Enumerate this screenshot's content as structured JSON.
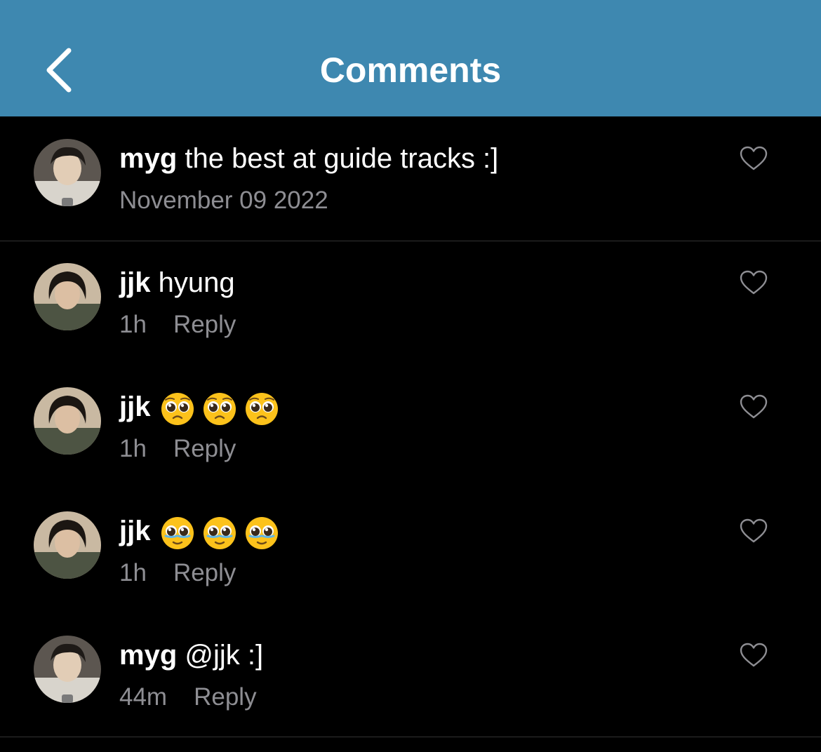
{
  "header": {
    "title": "Comments",
    "back_icon": "chevron-left-icon",
    "background_color": "#3e88b0"
  },
  "caption": {
    "username": "myg",
    "text": " the best at guide tracks :]",
    "date": "November 09 2022",
    "like_icon": "heart-outline-icon"
  },
  "comments": [
    {
      "username": "jjk",
      "text": " hyung",
      "time": "1h",
      "reply_label": "Reply",
      "like_icon": "heart-outline-icon"
    },
    {
      "username": "jjk",
      "emojis": [
        "pleading-face-emoji",
        "pleading-face-emoji",
        "pleading-face-emoji"
      ],
      "time": "1h",
      "reply_label": "Reply",
      "like_icon": "heart-outline-icon"
    },
    {
      "username": "jjk",
      "emojis": [
        "face-holding-back-tears-emoji",
        "face-holding-back-tears-emoji",
        "face-holding-back-tears-emoji"
      ],
      "time": "1h",
      "reply_label": "Reply",
      "like_icon": "heart-outline-icon"
    },
    {
      "username": "myg",
      "text": " @jjk :]",
      "time": "44m",
      "reply_label": "Reply",
      "like_icon": "heart-outline-icon"
    }
  ]
}
